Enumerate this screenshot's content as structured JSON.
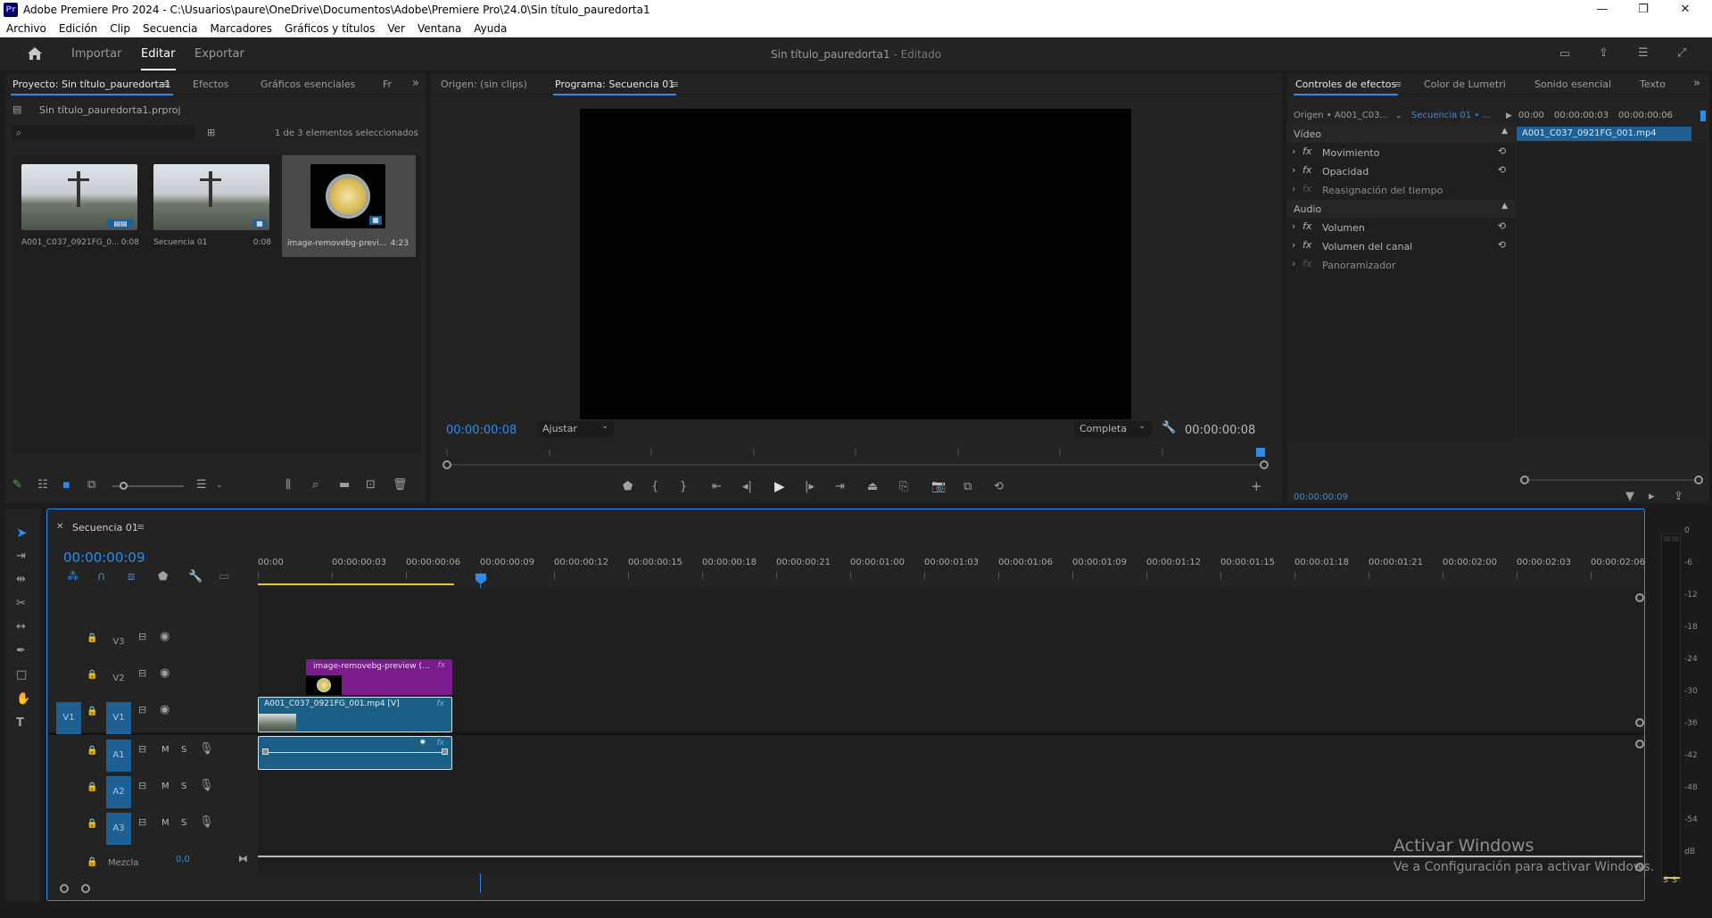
{
  "window": {
    "title": "Adobe Premiere Pro 2024 - C:\\Usuarios\\paure\\OneDrive\\Documentos\\Adobe\\Premiere Pro\\24.0\\Sin título_pauredorta1",
    "app_badge": "Pr"
  },
  "menu": [
    "Archivo",
    "Edición",
    "Clip",
    "Secuencia",
    "Marcadores",
    "Gráficos y títulos",
    "Ver",
    "Ventana",
    "Ayuda"
  ],
  "header": {
    "modes": [
      "Importar",
      "Editar",
      "Exportar"
    ],
    "active_mode": "Editar",
    "project_title": "Sin título_pauredorta1",
    "project_status": "- Editado"
  },
  "project_panel": {
    "tabs": [
      "Proyecto: Sin título_pauredorta1",
      "Efectos",
      "Gráficos esenciales",
      "Fr"
    ],
    "file": "Sin título_pauredorta1.prproj",
    "search_placeholder": "",
    "selection_info": "1 de 3 elementos seleccionados",
    "items": [
      {
        "name": "A001_C037_0921FG_0...",
        "duration": "0:08"
      },
      {
        "name": "Secuencia 01",
        "duration": "0:08"
      },
      {
        "name": "image-removebg-previ...",
        "duration": "4:23"
      }
    ]
  },
  "program_monitor": {
    "tabs": [
      "Origen: (sin clips)",
      "Programa: Secuencia 01"
    ],
    "timecode_left": "00:00:00:08",
    "fit": "Ajustar",
    "quality": "Completa",
    "timecode_right": "00:00:00:08",
    "playhead_fraction": 1.0
  },
  "effect_controls": {
    "tabs": [
      "Controles de efectos",
      "Color de Lumetri",
      "Sonido esencial",
      "Texto"
    ],
    "source": "Origen • A001_C03...",
    "sequence": "Secuencia 01 • ...",
    "ruler": [
      "00:00",
      "00:00:00:03",
      "00:00:00:06"
    ],
    "clip_name": "A001_C037_0921FG_001.mp4",
    "video_header": "Vídeo",
    "video_effects": [
      "Movimiento",
      "Opacidad",
      "Reasignación del tiempo"
    ],
    "audio_header": "Audio",
    "audio_effects": [
      "Volumen",
      "Volumen del canal",
      "Panoramizador"
    ],
    "timecode": "00:00:00:09"
  },
  "timeline": {
    "sequence_name": "Secuencia 01",
    "timecode": "00:00:00:09",
    "ruler": [
      "00:00",
      "00:00:00:03",
      "00:00:00:06",
      "00:00:00:09",
      "00:00:00:12",
      "00:00:00:15",
      "00:00:00:18",
      "00:00:00:21",
      "00:00:01:00",
      "00:00:01:03",
      "00:00:01:06",
      "00:00:01:09",
      "00:00:01:12",
      "00:00:01:15",
      "00:00:01:18",
      "00:00:01:21",
      "00:00:02:00",
      "00:00:02:03",
      "00:00:02:06"
    ],
    "video_tracks": [
      "V3",
      "V2",
      "V1"
    ],
    "audio_tracks": [
      "A1",
      "A2",
      "A3"
    ],
    "source_patch": "V1",
    "mix_label": "Mezcla",
    "mix_value": "0,0",
    "mute_label": "M",
    "solo_label": "S",
    "clips": {
      "v2": "image-removebg-preview (...",
      "v1": "A001_C037_0921FG_001.mp4 [V]"
    },
    "fx_badge": "fx"
  },
  "meter": {
    "scale": [
      "0",
      "-6",
      "-12",
      "-18",
      "-24",
      "-30",
      "-36",
      "-42",
      "-48",
      "-54",
      "dB"
    ],
    "solo": [
      "S",
      "S"
    ]
  },
  "watermark": {
    "title": "Activar Windows",
    "subtitle": "Ve a Configuración para activar Windows."
  }
}
